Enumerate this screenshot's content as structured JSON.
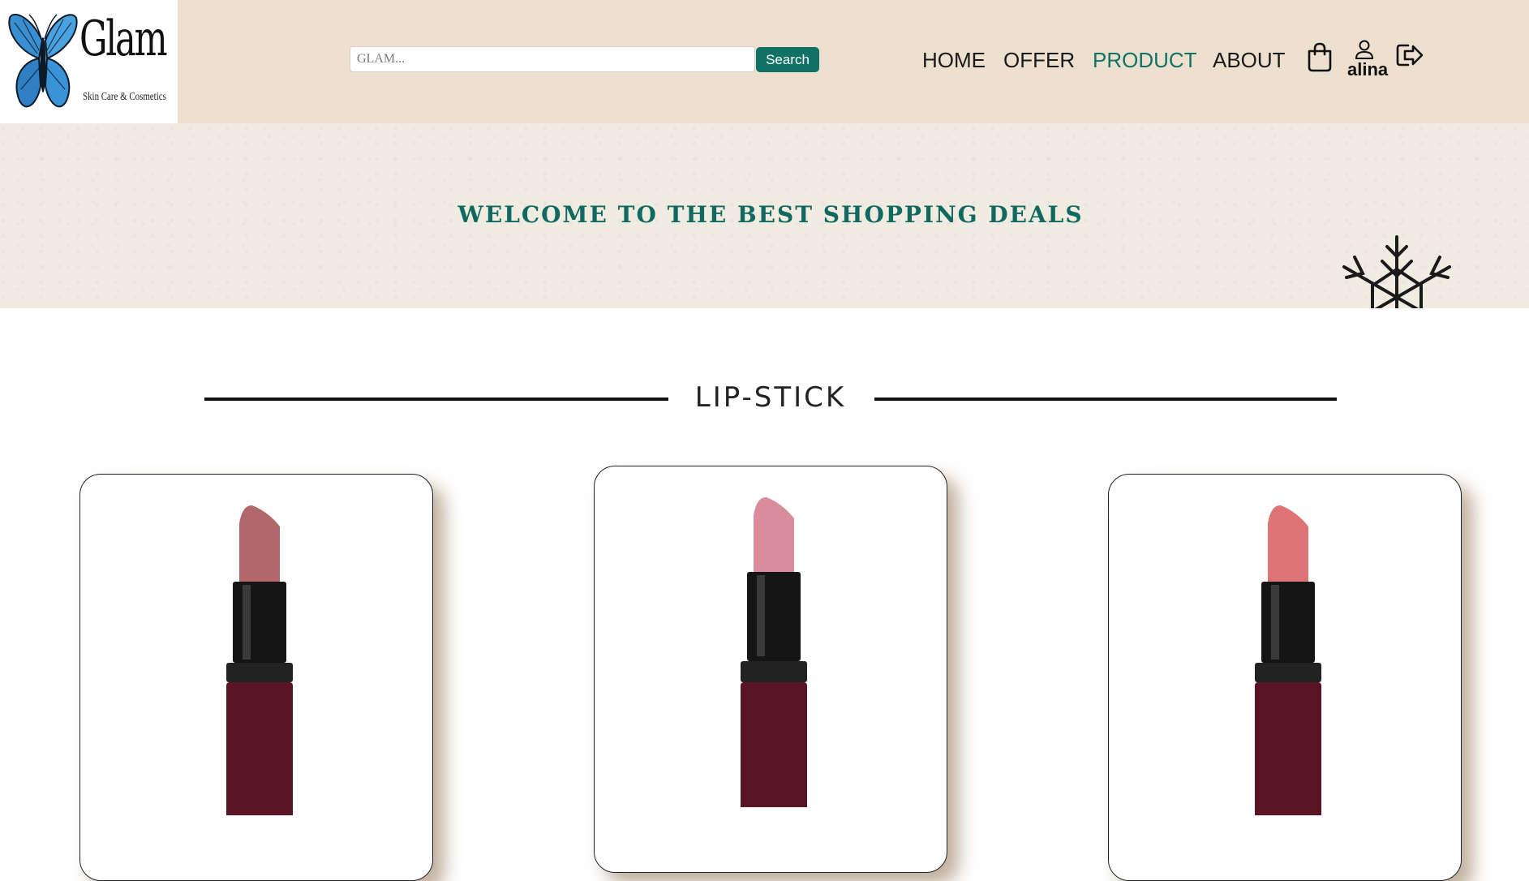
{
  "brand": {
    "name": "Glam",
    "tagline": "Skin Care & Cosmetics"
  },
  "search": {
    "placeholder": "GLAM...",
    "button_label": "Search"
  },
  "nav": {
    "items": [
      {
        "label": "HOME",
        "active": false
      },
      {
        "label": "OFFER",
        "active": false
      },
      {
        "label": "PRODUCT",
        "active": true
      },
      {
        "label": "ABOUT",
        "active": false
      }
    ]
  },
  "user": {
    "name": "alina"
  },
  "banner": {
    "headline": "WELCOME TO THE BEST SHOPPING DEALS"
  },
  "section": {
    "title": "LIP-STICK"
  },
  "products": [
    {
      "shade_color": "#b0686b"
    },
    {
      "shade_color": "#d98d9c"
    },
    {
      "shade_color": "#df7475"
    }
  ],
  "colors": {
    "accent": "#0f7265",
    "header_bg": "#eee0cf",
    "banner_bg": "#f1ece2"
  }
}
